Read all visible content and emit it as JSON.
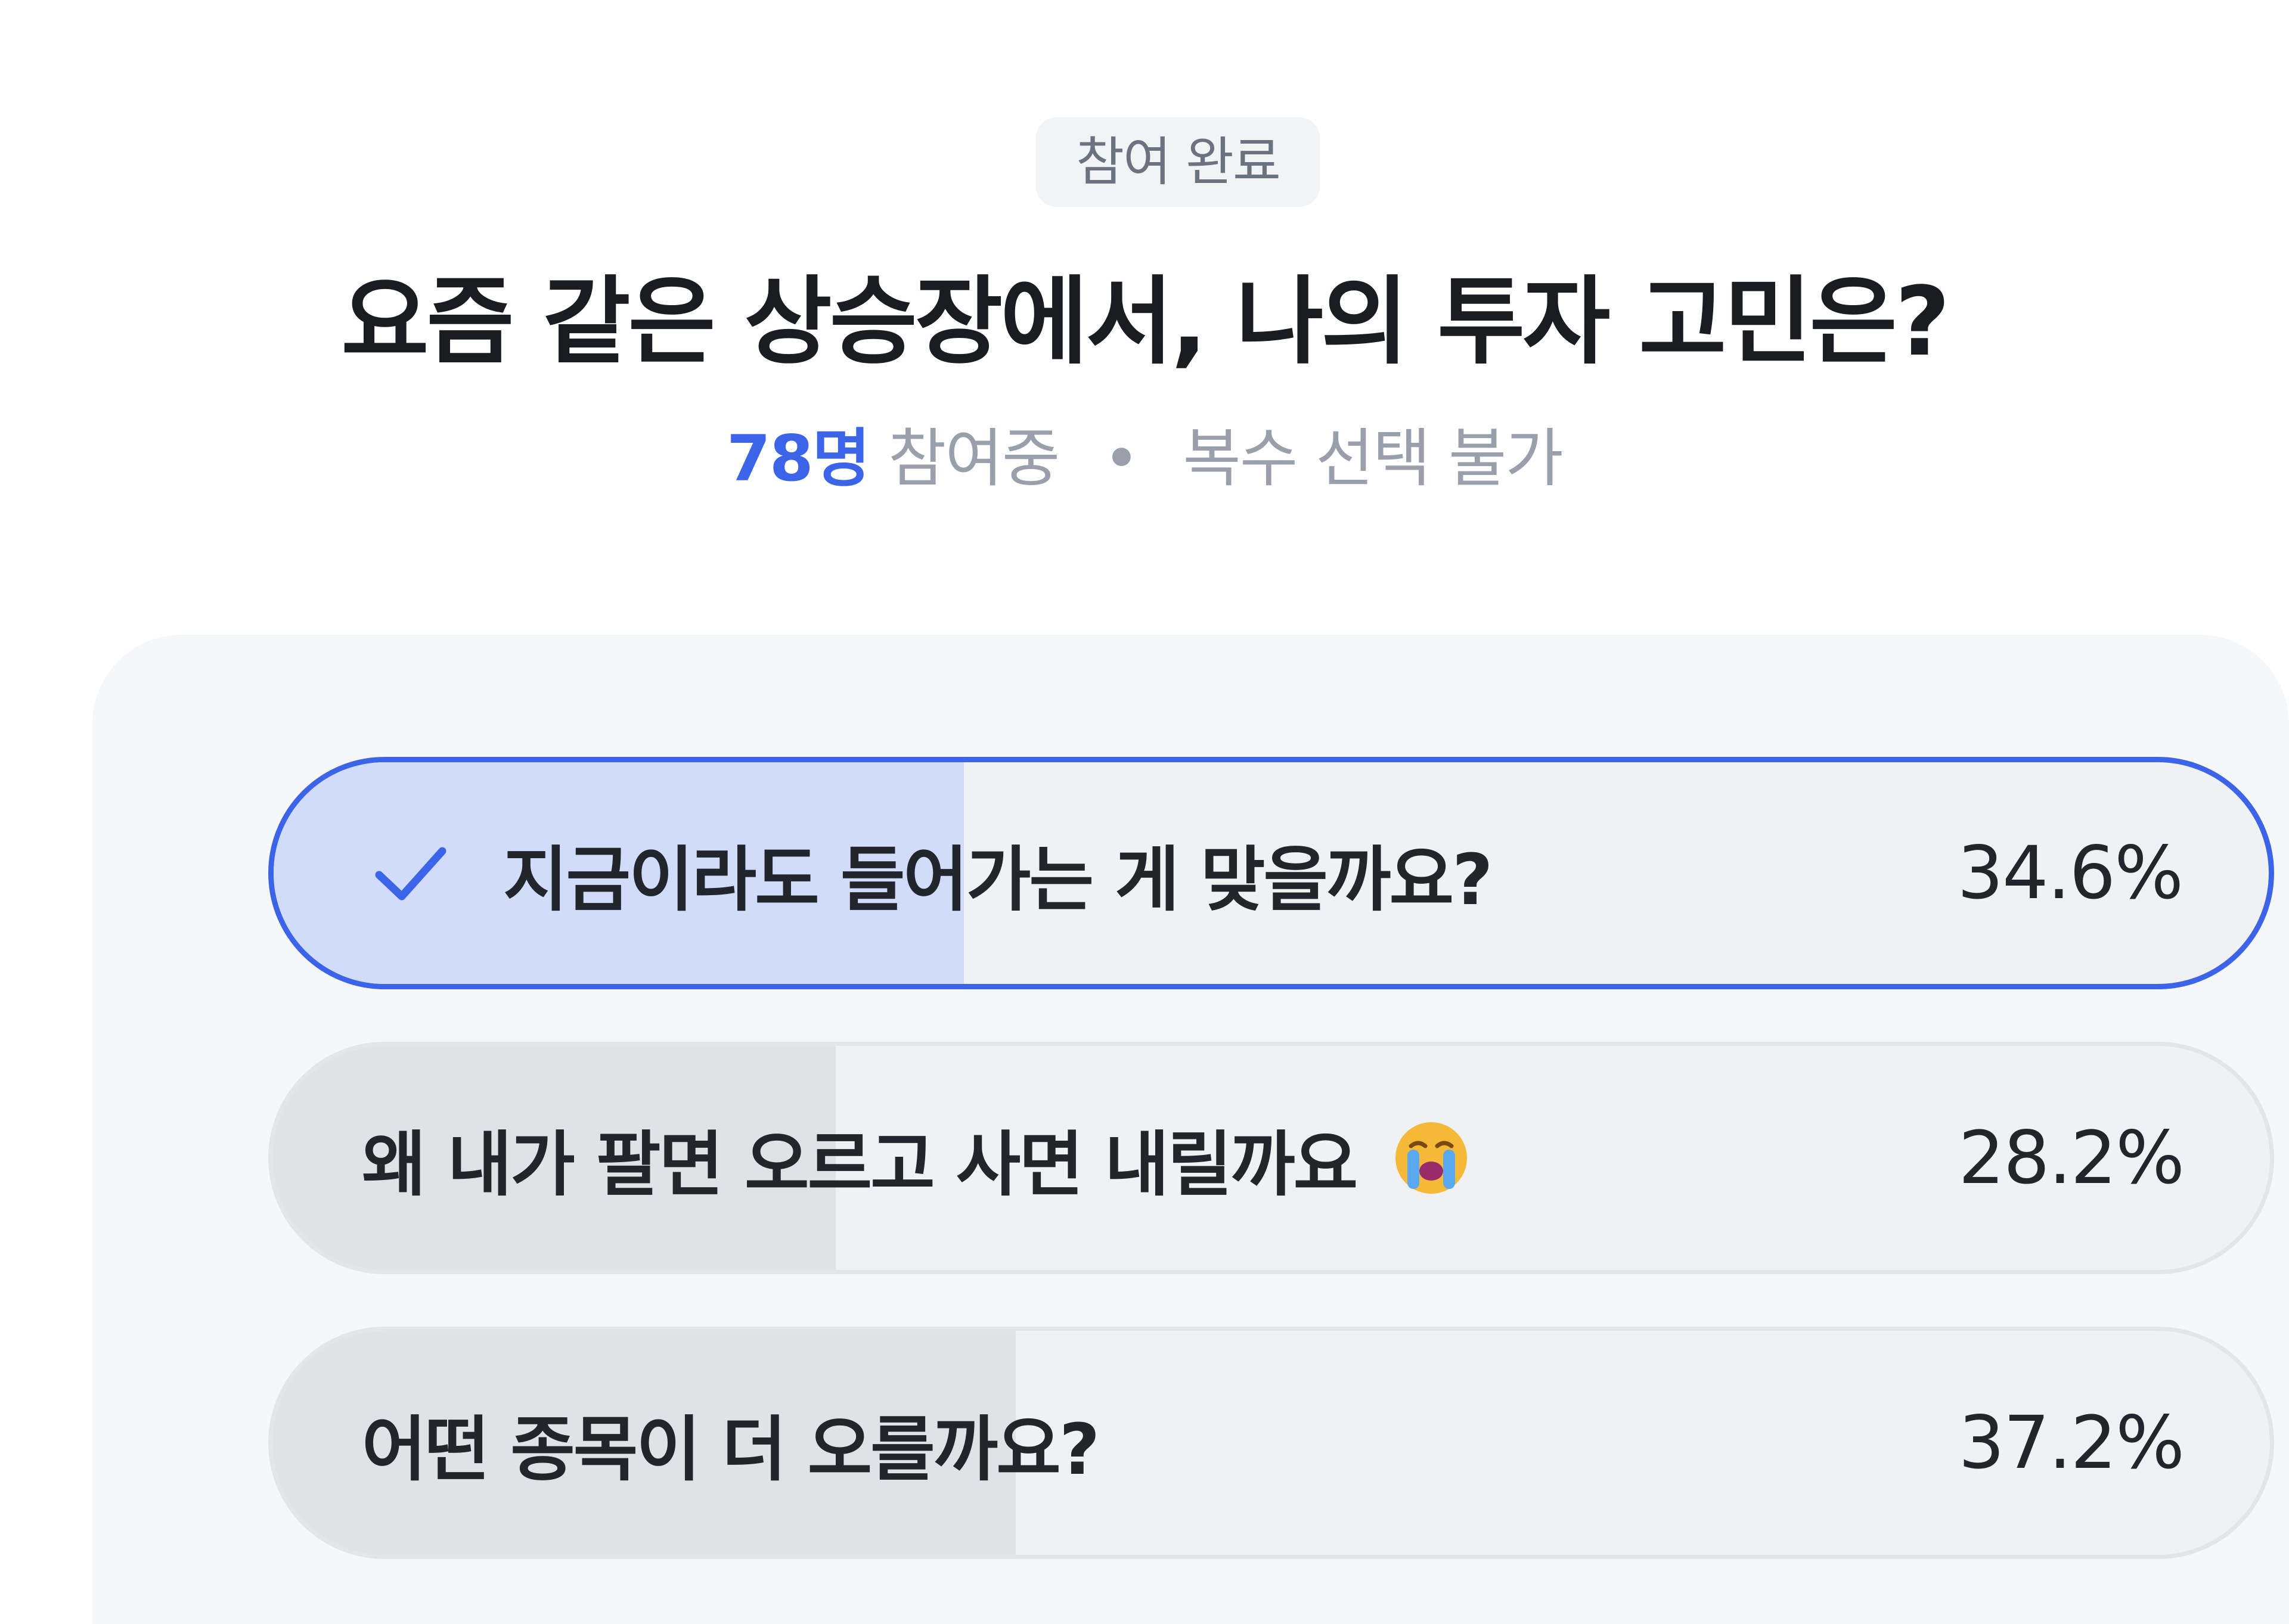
{
  "header": {
    "status_badge": "참여 완료",
    "title": "요즘 같은 상승장에서, 나의 투자 고민은?",
    "participant_count": "78명",
    "participating_label": "참여중",
    "separator": "•",
    "selection_rule": "복수 선택 불가"
  },
  "poll": {
    "options": [
      {
        "label": "지금이라도 들어가는 게 맞을까요?",
        "percent_text": "34.6%",
        "percent": 34.6,
        "selected": true,
        "icon": "check-icon"
      },
      {
        "label": "왜 내가 팔면 오르고 사면 내릴까요",
        "percent_text": "28.2%",
        "percent": 28.2,
        "selected": false,
        "icon": "crying-face-emoji-icon"
      },
      {
        "label": "어떤 종목이 더 오를까요?",
        "percent_text": "37.2%",
        "percent": 37.2,
        "selected": false
      }
    ]
  },
  "colors": {
    "accent": "#3b64e8",
    "selected_fill": "#d1dbfa",
    "bar_fill": "#e1e2e6",
    "card_background": "#f6f7f9"
  }
}
